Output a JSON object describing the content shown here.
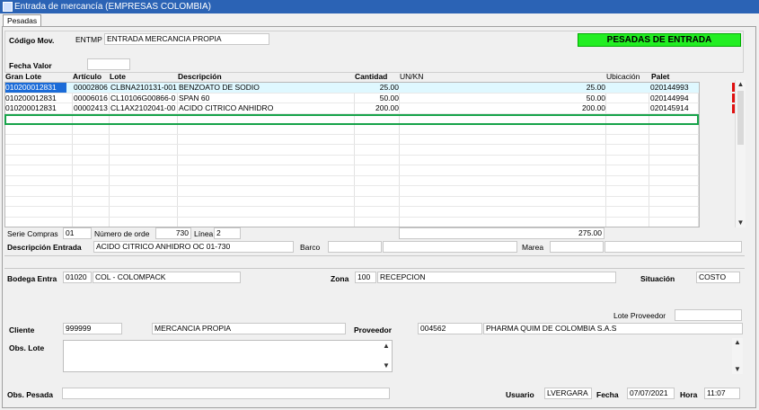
{
  "window": {
    "title": "Entrada de mercancía (EMPRESAS COLOMBIA)",
    "app_icon": "app-window-icon"
  },
  "tab": {
    "label": "Pesadas"
  },
  "header": {
    "codigo_mov_label": "Código Mov.",
    "codigo_mov_code": "ENTMP",
    "codigo_mov_desc": "ENTRADA MERCANCIA PROPIA",
    "fecha_valor_label": "Fecha Valor",
    "fecha_valor_value": "",
    "badge": "PESADAS DE ENTRADA",
    "badge_color": "#22ee22"
  },
  "grid": {
    "headers": {
      "gran_lote": "Gran Lote",
      "articulo": "Artículo",
      "lote": "Lote",
      "descripcion": "Descripción",
      "cantidad": "Cantidad",
      "un_kn": "UN/KN",
      "ubicacion": "Ubicación",
      "palet": "Palet"
    },
    "rows": [
      {
        "gran_lote": "010200012831",
        "articulo": "00002806",
        "lote": "CLBNA210131-001",
        "descripcion": "BENZOATO DE SODIO",
        "cantidad": "25.00",
        "un_kn": "25.00",
        "palet": "020144993"
      },
      {
        "gran_lote": "010200012831",
        "articulo": "00006016",
        "lote": "CL10106G00866-0",
        "descripcion": "SPAN 60",
        "cantidad": "50.00",
        "un_kn": "50.00",
        "palet": "020144994"
      },
      {
        "gran_lote": "010200012831",
        "articulo": "00002413",
        "lote": "CL1AX2102041-00",
        "descripcion": "ACIDO CITRICO ANHIDRO",
        "cantidad": "200.00",
        "un_kn": "200.00",
        "palet": "020145914"
      }
    ]
  },
  "summary": {
    "serie_compras_label": "Serie Compras",
    "serie_compras_value": "01",
    "numero_orden_label": "Número de orde",
    "numero_orden_value": "730",
    "linea_label": "Línea",
    "linea_value": "2",
    "total": "275.00"
  },
  "details": {
    "descripcion_entrada_label": "Descripción Entrada",
    "descripcion_entrada_value": "ACIDO CITRICO ANHIDRO OC 01-730",
    "barco_label": "Barco",
    "barco_value": "",
    "marea_label": "Marea",
    "marea_value": "",
    "bodega_label": "Bodega Entra",
    "bodega_code": "01020",
    "bodega_name": "COL - COLOMPACK",
    "zona_label": "Zona",
    "zona_code": "100",
    "zona_name": "RECEPCION",
    "situacion_label": "Situación",
    "situacion_value": "COSTO",
    "lote_proveedor_label": "Lote Proveedor",
    "lote_proveedor_value": "",
    "cliente_label": "Cliente",
    "cliente_code": "999999",
    "cliente_name": "MERCANCIA PROPIA",
    "proveedor_label": "Proveedor",
    "proveedor_code": "004562",
    "proveedor_name": "PHARMA QUIM DE COLOMBIA S.A.S",
    "obs_lote_label": "Obs. Lote",
    "obs_lote_value": "",
    "obs_pesada_label": "Obs. Pesada",
    "obs_pesada_value": ""
  },
  "footer": {
    "usuario_label": "Usuario",
    "usuario_value": "LVERGARA",
    "fecha_label": "Fecha",
    "fecha_value": "07/07/2021",
    "hora_label": "Hora",
    "hora_value": "11:07"
  },
  "icons": {
    "scroll_up": "scroll-up-arrow-icon",
    "scroll_down": "scroll-down-arrow-icon"
  }
}
